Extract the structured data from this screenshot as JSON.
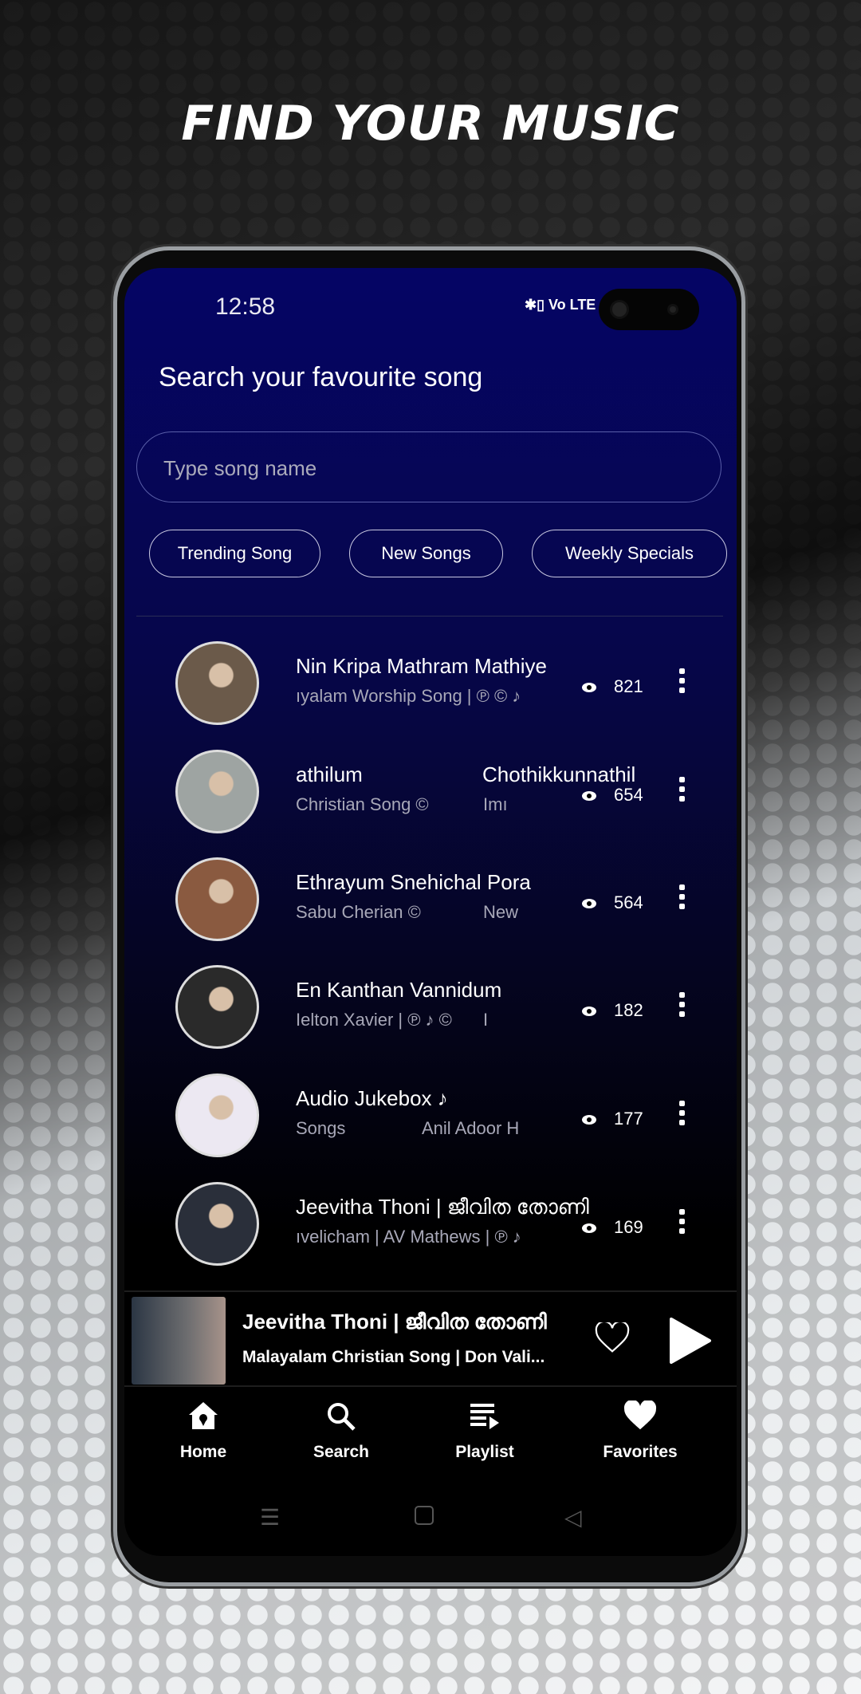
{
  "promo_title": "FIND YOUR MUSIC",
  "status": {
    "time": "12:58",
    "icons": "✱▯ Vo LTE ⇕5G"
  },
  "heading": "Search your favourite song",
  "search": {
    "placeholder": "Type song name",
    "value": ""
  },
  "chips": [
    "Trending Song",
    "New Songs",
    "Weekly Specials"
  ],
  "songs": [
    {
      "title": "Nin Kripa Mathram Mathiye",
      "title2": "",
      "subtitle": "ıyalam Worship Song | ℗ © ♪",
      "subtitle2": "",
      "views": "821",
      "thumb": "#6b5a4a"
    },
    {
      "title": "athilum",
      "title2": "Chothikkunnathil",
      "subtitle": "Christian Song ©",
      "subtitle2": "Imı",
      "views": "654",
      "thumb": "#9ea4a2"
    },
    {
      "title": "Ethrayum Snehichal Pora",
      "title2": "",
      "subtitle": "Sabu Cherian ©",
      "subtitle2": "New",
      "views": "564",
      "thumb": "#8a5a40"
    },
    {
      "title": "En Kanthan Vannidum",
      "title2": "",
      "subtitle": "Ielton Xavier | ℗ ♪ ©",
      "subtitle2": "I",
      "views": "182",
      "thumb": "#2a2a2a"
    },
    {
      "title": "Audio Jukebox ♪",
      "title2": "",
      "subtitle": "Songs",
      "subtitle2": "Anil Adoor H",
      "views": "177",
      "thumb": "#ece8f2"
    },
    {
      "title": "Jeevitha Thoni | ജീവിത തോണി",
      "title2": "",
      "subtitle": "ıvelicham | AV Mathews | ℗ ♪",
      "subtitle2": "",
      "views": "169",
      "thumb": "#2a2f3a"
    }
  ],
  "now_playing": {
    "title": "Jeevitha Thoni | ജീവിത തോണി",
    "subtitle": "Malayalam Christian Song | Don Vali..."
  },
  "nav": [
    {
      "label": "Home",
      "icon": "home-icon"
    },
    {
      "label": "Search",
      "icon": "search-icon"
    },
    {
      "label": "Playlist",
      "icon": "playlist-icon"
    },
    {
      "label": "Favorites",
      "icon": "heart-icon"
    }
  ]
}
